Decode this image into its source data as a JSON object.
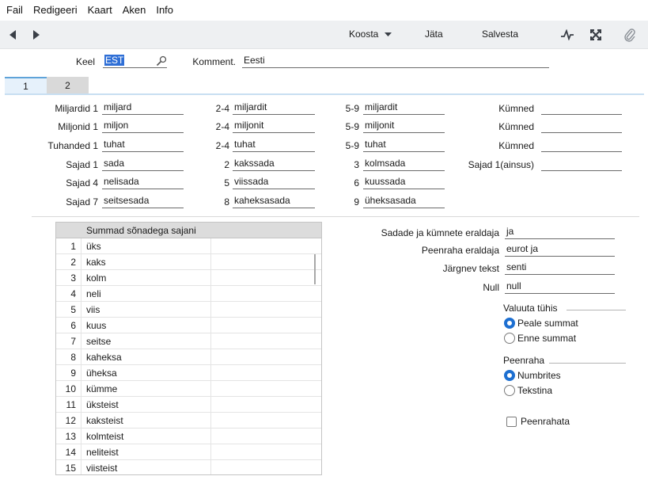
{
  "menu": [
    "Fail",
    "Redigeeri",
    "Kaart",
    "Aken",
    "Info"
  ],
  "toolbar": {
    "create": "Koosta",
    "skip": "Jäta",
    "save": "Salvesta"
  },
  "header": {
    "lang_label": "Keel",
    "lang_value": "EST",
    "comment_label": "Komment.",
    "comment_value": "Eesti"
  },
  "tabs": [
    "1",
    "2"
  ],
  "words": {
    "rows": [
      {
        "label1": "Miljardid 1",
        "v1": "miljard",
        "label2": "2-4",
        "v2": "miljardit",
        "label3": "5-9",
        "v3": "miljardit",
        "label4": "Kümned",
        "v4": ""
      },
      {
        "label1": "Miljonid 1",
        "v1": "miljon",
        "label2": "2-4",
        "v2": "miljonit",
        "label3": "5-9",
        "v3": "miljonit",
        "label4": "Kümned",
        "v4": ""
      },
      {
        "label1": "Tuhanded 1",
        "v1": "tuhat",
        "label2": "2-4",
        "v2": "tuhat",
        "label3": "5-9",
        "v3": "tuhat",
        "label4": "Kümned",
        "v4": ""
      },
      {
        "label1": "Sajad 1",
        "v1": "sada",
        "label2": "2",
        "v2": "kakssada",
        "label3": "3",
        "v3": "kolmsada",
        "label4": "Sajad 1(ainsus)",
        "v4": ""
      },
      {
        "label1": "Sajad 4",
        "v1": "nelisada",
        "label2": "5",
        "v2": "viissada",
        "label3": "6",
        "v3": "kuussada"
      },
      {
        "label1": "Sajad 7",
        "v1": "seitsesada",
        "label2": "8",
        "v2": "kaheksasada",
        "label3": "9",
        "v3": "üheksasada"
      }
    ]
  },
  "grid": {
    "title": "Summad sõnadega sajani",
    "rows": [
      {
        "n": "1",
        "w": "üks"
      },
      {
        "n": "2",
        "w": "kaks"
      },
      {
        "n": "3",
        "w": "kolm"
      },
      {
        "n": "4",
        "w": "neli"
      },
      {
        "n": "5",
        "w": "viis"
      },
      {
        "n": "6",
        "w": "kuus"
      },
      {
        "n": "7",
        "w": "seitse"
      },
      {
        "n": "8",
        "w": "kaheksa"
      },
      {
        "n": "9",
        "w": "üheksa"
      },
      {
        "n": "10",
        "w": "kümme"
      },
      {
        "n": "11",
        "w": "üksteist"
      },
      {
        "n": "12",
        "w": "kaksteist"
      },
      {
        "n": "13",
        "w": "kolmteist"
      },
      {
        "n": "14",
        "w": "neliteist"
      },
      {
        "n": "15",
        "w": "viisteist"
      }
    ]
  },
  "right": {
    "fields": [
      {
        "label": "Sadade ja kümnete eraldaja",
        "value": "ja"
      },
      {
        "label": "Peenraha eraldaja",
        "value": "eurot ja"
      },
      {
        "label": "Järgnev tekst",
        "value": "senti"
      },
      {
        "label": "Null",
        "value": "null"
      }
    ],
    "currency_void": {
      "title": "Valuuta tühis",
      "options": [
        "Peale summat",
        "Enne summat"
      ],
      "selected": 0
    },
    "cents": {
      "title": "Peenraha",
      "options": [
        "Numbrites",
        "Tekstina"
      ],
      "selected": 0
    },
    "no_cents": "Peenrahata"
  },
  "colors": {
    "accent": "#1d6fd1",
    "tab_active": "#e6f1fb",
    "toolbar_bg": "#eef0f2"
  },
  "icons": [
    "back-arrow-icon",
    "forward-arrow-icon",
    "dropdown-caret-icon",
    "pulse-icon",
    "expand-icon",
    "attachment-icon",
    "search-icon"
  ]
}
